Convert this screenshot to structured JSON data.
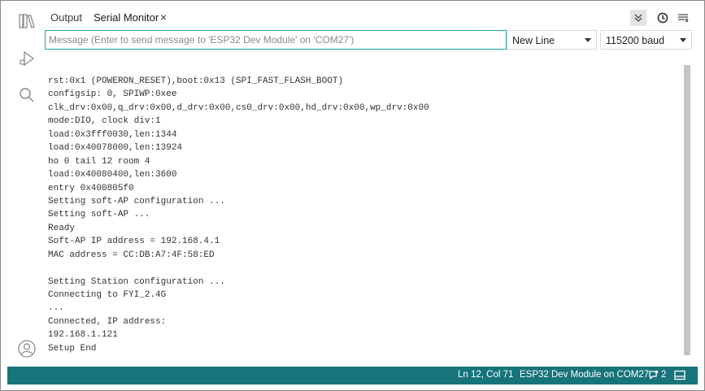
{
  "tabs": {
    "output_label": "Output",
    "serial_label": "Serial Monitor",
    "close_glyph": "×"
  },
  "toolbar": {
    "collapse_icon": "chevrons-down-icon",
    "timestamp_icon": "clock-icon",
    "clear_icon": "clear-output-icon"
  },
  "sidebar": {
    "items": [
      {
        "name": "library-icon"
      },
      {
        "name": "debug-icon"
      },
      {
        "name": "search-icon"
      },
      {
        "name": "account-icon"
      }
    ]
  },
  "message": {
    "placeholder": "Message (Enter to send message to 'ESP32 Dev Module' on 'COM27')",
    "value": ""
  },
  "line_ending": {
    "selected": "New Line"
  },
  "baud_rate": {
    "selected": "115200 baud"
  },
  "serial_output": {
    "lines": [
      "rst:0x1 (POWERON_RESET),boot:0x13 (SPI_FAST_FLASH_BOOT)",
      "configsip: 0, SPIWP:0xee",
      "clk_drv:0x00,q_drv:0x00,d_drv:0x00,cs0_drv:0x00,hd_drv:0x00,wp_drv:0x00",
      "mode:DIO, clock div:1",
      "load:0x3fff0030,len:1344",
      "load:0x40078000,len:13924",
      "ho 0 tail 12 room 4",
      "load:0x40080400,len:3600",
      "entry 0x400805f0",
      "Setting soft-AP configuration ...",
      "Setting soft-AP ...",
      "Ready",
      "Soft-AP IP address = 192.168.4.1",
      "MAC address = CC:DB:A7:4F:58:ED",
      "",
      "Setting Station configuration ...",
      "Connecting to FYI_2.4G",
      "...",
      "Connected, IP address:",
      "192.168.1.121",
      "Setup End"
    ]
  },
  "status": {
    "cursor": "Ln 12, Col 71",
    "board": "ESP32 Dev Module on COM27",
    "notifications_count": "2",
    "background": "#17747a"
  }
}
